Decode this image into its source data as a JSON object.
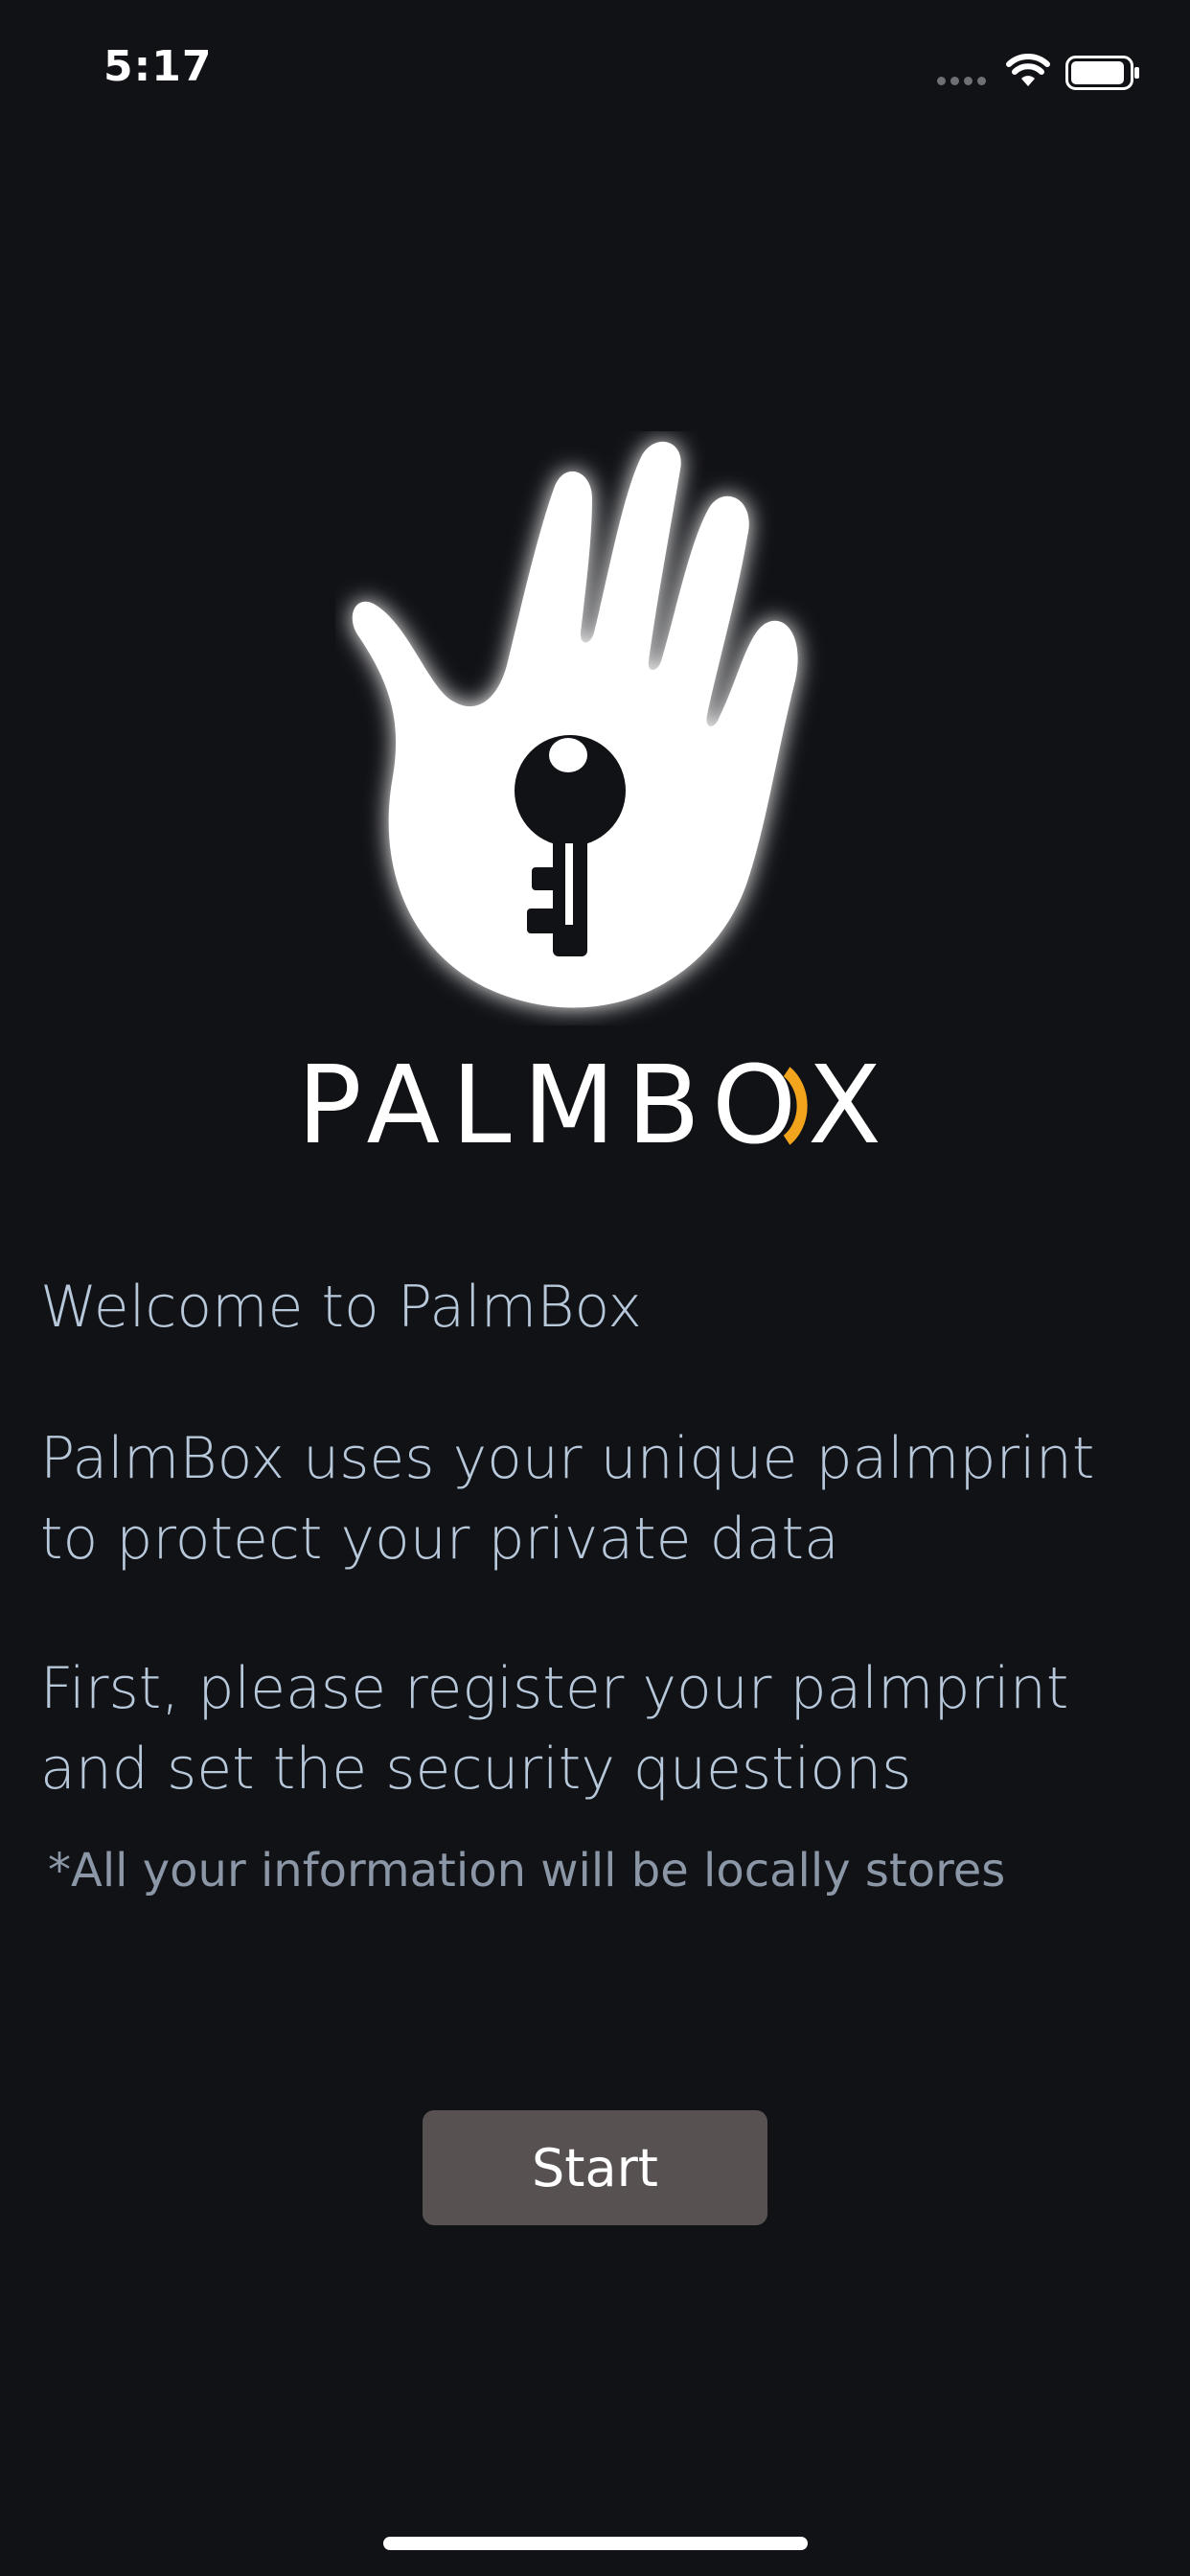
{
  "status_bar": {
    "time": "5:17",
    "icons": [
      "signal-dots-icon",
      "wifi-icon",
      "battery-icon"
    ]
  },
  "branding": {
    "logo_icon": "hand-with-key-icon",
    "name_pre": "PALMB",
    "name_o": "O",
    "name_post": "X",
    "accent_color": "#F3A41D"
  },
  "content": {
    "welcome": "Welcome to PalmBox",
    "uses_line1": "PalmBox uses your unique palmprint",
    "uses_line2": "to protect your private data",
    "first_line1": "First, please register your palmprint",
    "first_line2": "and set the security questions",
    "note": "*All your information will be locally stores"
  },
  "actions": {
    "start_label": "Start"
  },
  "colors": {
    "background": "#111216",
    "text": "#B7C8DB",
    "note_text": "#8B97A6",
    "button_bg": "#585151"
  }
}
